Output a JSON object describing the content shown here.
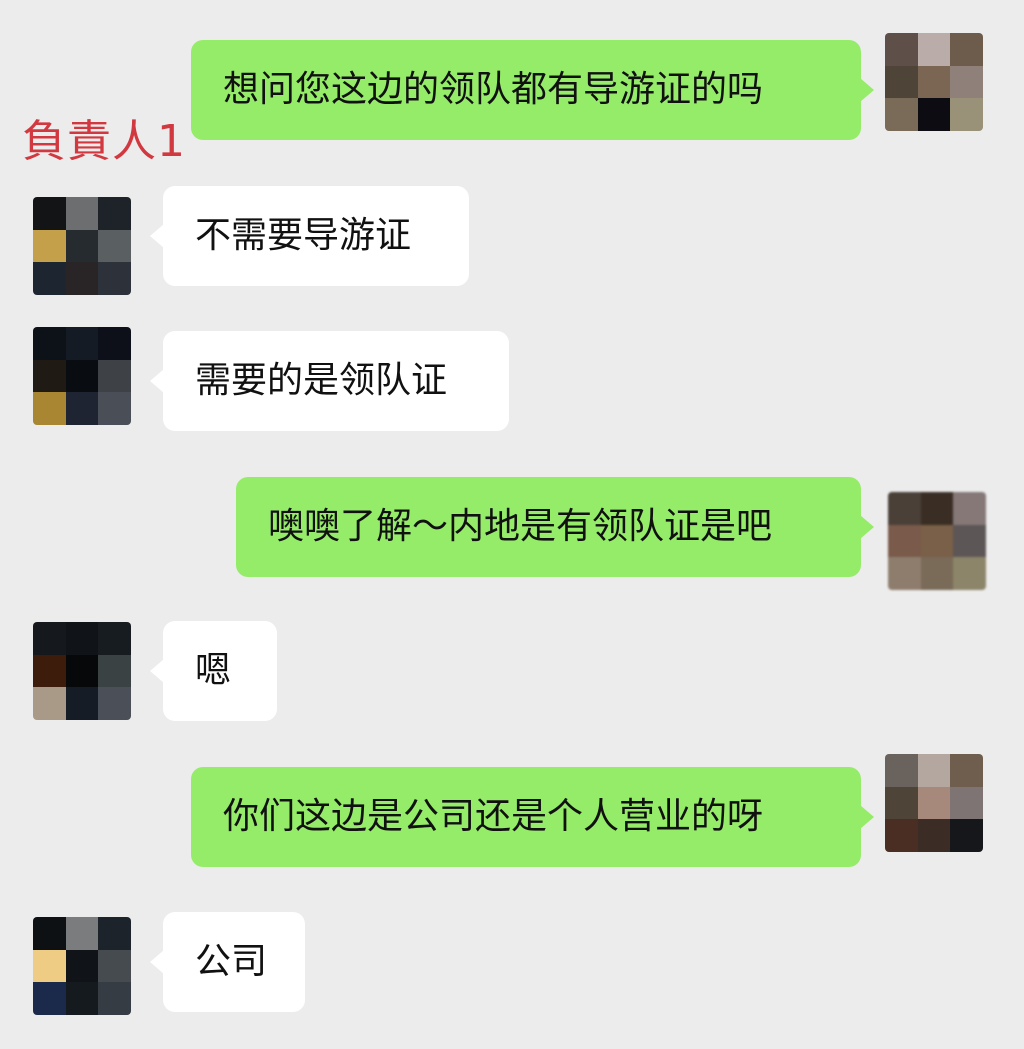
{
  "annotation": "負責人1",
  "messages": [
    {
      "side": "out",
      "text": "想问您这边的领队都有导游证的吗"
    },
    {
      "side": "in",
      "text": "不需要导游证"
    },
    {
      "side": "in",
      "text": "需要的是领队证"
    },
    {
      "side": "out",
      "text": "噢噢了解～内地是有领队证是吧"
    },
    {
      "side": "in",
      "text": "嗯"
    },
    {
      "side": "out",
      "text": "你们这边是公司还是个人营业的呀"
    },
    {
      "side": "in",
      "text": "公司"
    }
  ],
  "colors": {
    "background": "#ececec",
    "outgoing_bubble": "#95ec69",
    "incoming_bubble": "#ffffff",
    "annotation": "#d2383f"
  }
}
